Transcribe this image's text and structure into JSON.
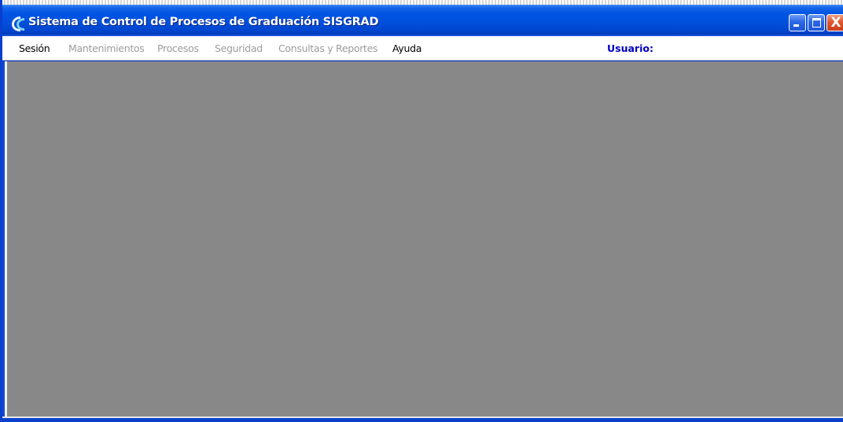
{
  "window": {
    "title": "Sistema de Control de Procesos de Graduación SISGRAD",
    "icon": "sisgrad-logo-icon",
    "controls": {
      "minimize_icon": "minimize-icon",
      "maximize_icon": "maximize-icon",
      "close_icon": "close-icon",
      "close_glyph": "X"
    }
  },
  "menu": {
    "items": [
      {
        "label": "Sesión",
        "enabled": true
      },
      {
        "label": "Mantenimientos",
        "enabled": false
      },
      {
        "label": "Procesos",
        "enabled": false
      },
      {
        "label": "Seguridad",
        "enabled": false
      },
      {
        "label": "Consultas y Reportes",
        "enabled": false
      },
      {
        "label": "Ayuda",
        "enabled": true
      }
    ],
    "user_label": "Usuario:"
  },
  "colors": {
    "title_bar": "#0054e3",
    "mdi_background": "#888888",
    "menu_disabled": "#9c9c9c",
    "user_label": "#0000c0",
    "close_button": "#e2552f"
  }
}
